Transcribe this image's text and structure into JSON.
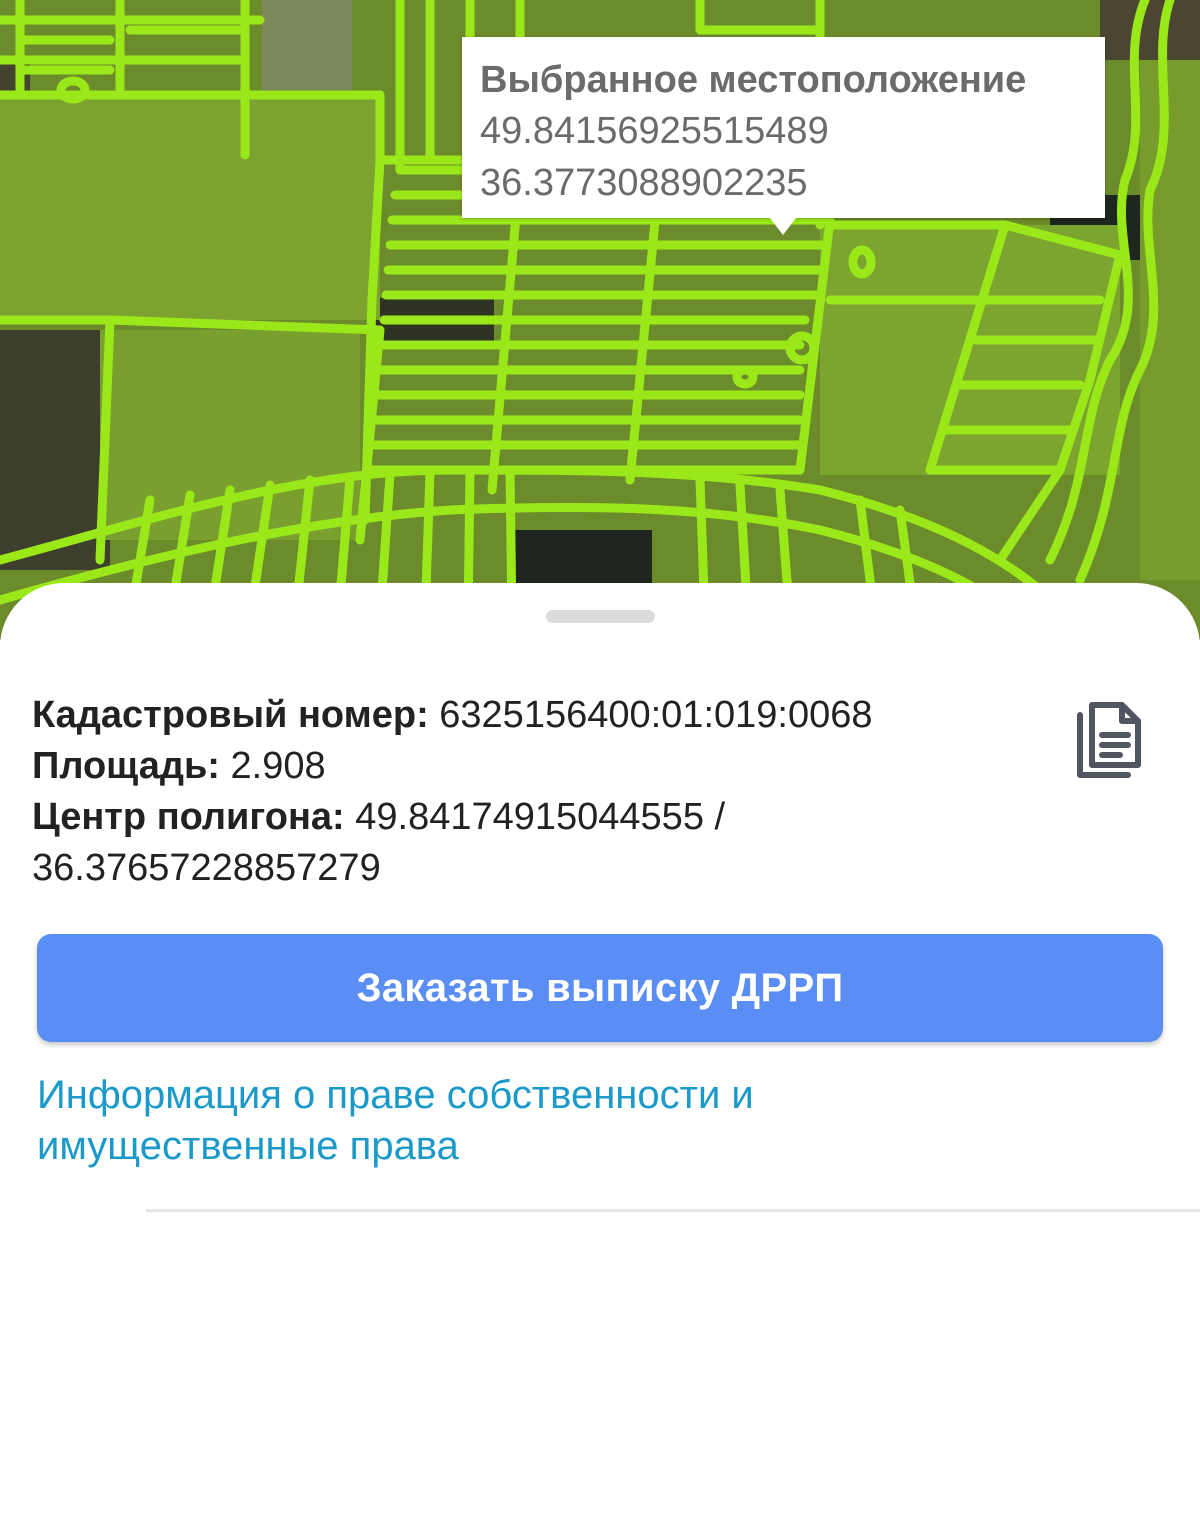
{
  "map": {
    "popup": {
      "title": "Выбранное местоположение",
      "latitude": "49.84156925515489",
      "longitude": "36.3773088902235"
    },
    "colors": {
      "parcel_outline": "#9be81a",
      "parcel_fill": "#7fb52a"
    }
  },
  "sheet": {
    "cadastral_label": "Кадастровый номер:",
    "cadastral_value": "6325156400:01:019:0068",
    "area_label": "Площадь:",
    "area_value": "2.908",
    "center_label": "Центр полигона:",
    "center_value_line1": "49.84174915044555 /",
    "center_value_line2": "36.37657228857279",
    "copy_icon": "copy-document-icon",
    "order_button_label": "Заказать выписку ДРРП",
    "rights_link_text": "Информация о праве собственности и имущественные права",
    "colors": {
      "button": "#5b8ef5",
      "link": "#1b9ac9"
    }
  }
}
